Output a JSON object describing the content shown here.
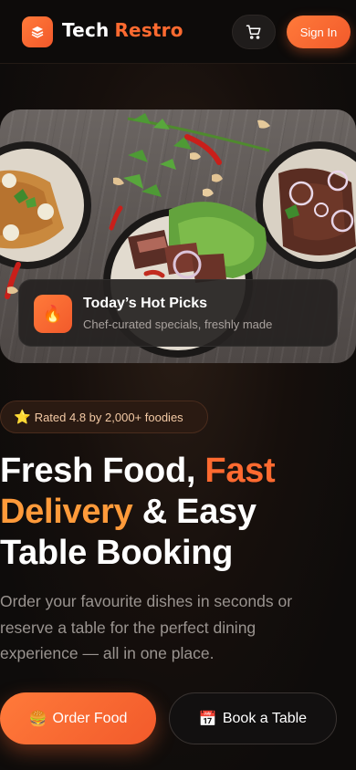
{
  "header": {
    "brand_part1": "Tech",
    "brand_part2": "Restro",
    "signin_label": "Sign In",
    "logo_icon": "layers-icon",
    "cart_icon": "cart-icon"
  },
  "hero": {
    "card_title": "Today’s Hot Picks",
    "card_subtitle": "Chef-curated specials, freshly made",
    "card_icon": "🔥"
  },
  "rating": {
    "star": "⭐",
    "text": "Rated 4.8 by 2,000+ foodies"
  },
  "headline": {
    "part1": "Fresh Food, ",
    "highlight1": "Fast",
    "highlight2": "Delivery",
    "part2": " & Easy",
    "part3": "Table Booking"
  },
  "description": "Order your favourite dishes in seconds or reserve a table for the perfect dining experience — all in one place.",
  "actions": {
    "order_emoji": "🍔",
    "order_label": "Order Food",
    "book_emoji": "📅",
    "book_label": "Book a Table"
  },
  "colors": {
    "accent": "#ff6a30",
    "accent_light": "#ff9a3a",
    "background": "#0e0c0b"
  }
}
